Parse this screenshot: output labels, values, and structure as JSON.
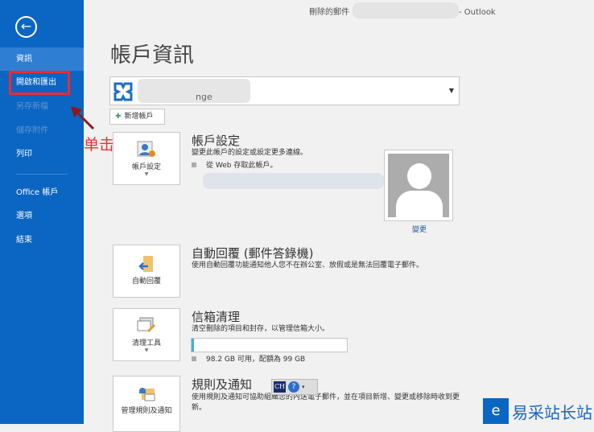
{
  "window_title": "刪除的郵件",
  "window_app": "- Outlook",
  "sidebar": {
    "items": [
      {
        "label": "資訊",
        "state": "selected"
      },
      {
        "label": "開啟和匯出",
        "state": "normal"
      },
      {
        "label": "另存新檔",
        "state": "disabled"
      },
      {
        "label": "儲存附件",
        "state": "disabled"
      },
      {
        "label": "列印",
        "state": "normal"
      },
      {
        "label": "Office 帳戶",
        "state": "normal"
      },
      {
        "label": "選項",
        "state": "normal"
      },
      {
        "label": "結束",
        "state": "normal"
      }
    ]
  },
  "annotation": "单击",
  "page_title": "帳戶資訊",
  "account": {
    "type_suffix": "nge"
  },
  "add_account": "新增帳戶",
  "sections": {
    "settings": {
      "button": "帳戶設定",
      "title": "帳戶設定",
      "desc": "變更此帳戶的設定或設定更多連線。",
      "bullet": "從 Web 存取此帳戶。"
    },
    "auto_reply": {
      "button": "自動回覆",
      "title": "自動回覆 (郵件答錄機)",
      "desc": "使用自動回覆功能通知他人您不在辦公室、放假或是無法回覆電子郵件。"
    },
    "cleanup": {
      "button": "清理工具",
      "title": "信箱清理",
      "desc": "清空刪除的項目和封存，以管理信箱大小。",
      "usage": "98.2 GB 可用，配額為 99 GB",
      "used_fraction": 0.008
    },
    "rules": {
      "button": "管理規則及通知",
      "title": "規則及通知",
      "desc": "使用規則及通知可協助組織您的內送電子郵件，並在項目新增、變更或移除時收到更新。"
    }
  },
  "avatar_change": "變更",
  "ime": {
    "lang": "CH",
    "help": "?"
  },
  "watermark": "易采站长站",
  "colors": {
    "sidebar": "#0b65c2",
    "accent": "#3ab4d6",
    "annotation": "#ee2b2b"
  }
}
